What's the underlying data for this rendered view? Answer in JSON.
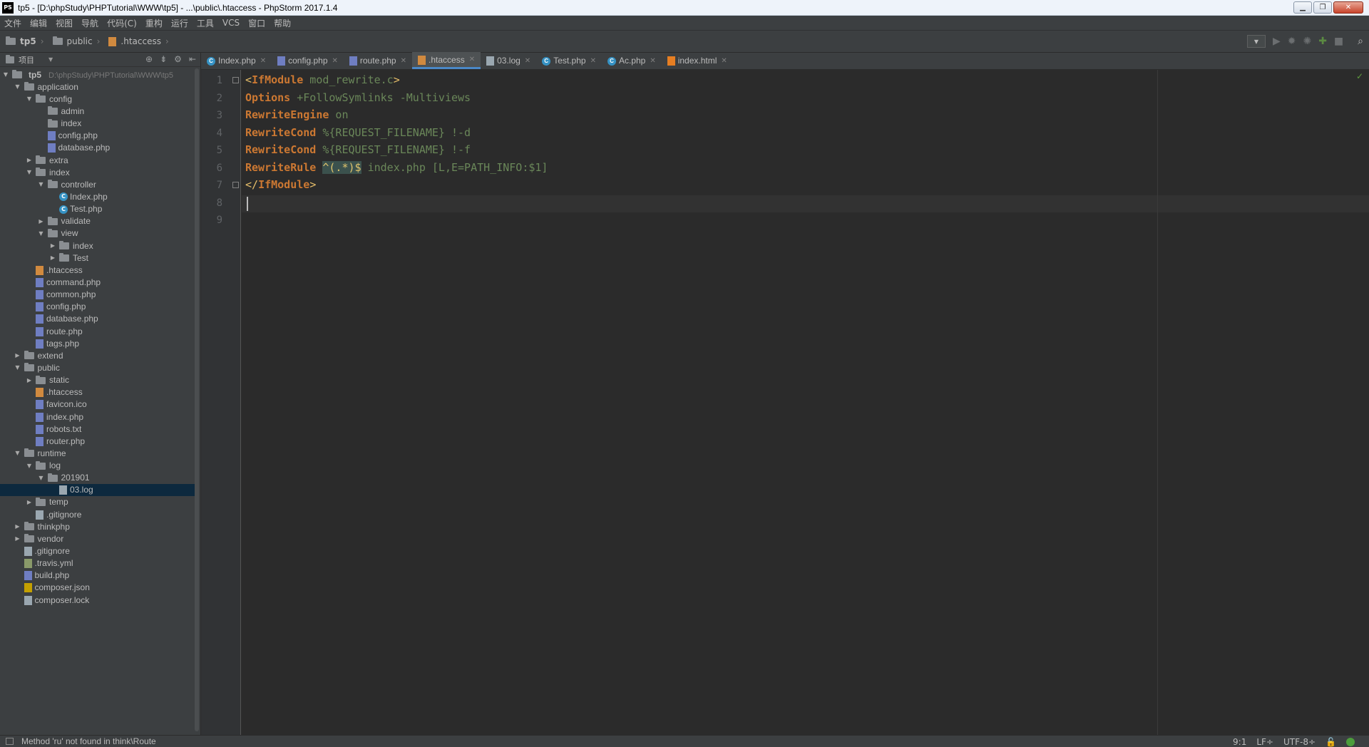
{
  "window": {
    "title": "tp5 - [D:\\phpStudy\\PHPTutorial\\WWW\\tp5] - ...\\public\\.htaccess - PhpStorm 2017.1.4",
    "logo": "PS"
  },
  "menu": [
    "文件",
    "编辑",
    "视图",
    "导航",
    "代码(C)",
    "重构",
    "运行",
    "工具",
    "VCS",
    "窗口",
    "帮助"
  ],
  "breadcrumb": [
    "tp5",
    "public",
    ".htaccess"
  ],
  "sidebar": {
    "header": "项目",
    "root_name": "tp5",
    "root_path": "D:\\phpStudy\\PHPTutorial\\WWW\\tp5",
    "items": [
      {
        "name": "application",
        "depth": 1,
        "kind": "folder",
        "expanded": true
      },
      {
        "name": "config",
        "depth": 2,
        "kind": "folder",
        "expanded": true
      },
      {
        "name": "admin",
        "depth": 3,
        "kind": "folder",
        "expanded": null
      },
      {
        "name": "index",
        "depth": 3,
        "kind": "folder",
        "expanded": null
      },
      {
        "name": "config.php",
        "depth": 3,
        "kind": "php"
      },
      {
        "name": "database.php",
        "depth": 3,
        "kind": "php"
      },
      {
        "name": "extra",
        "depth": 2,
        "kind": "folder",
        "expanded": false
      },
      {
        "name": "index",
        "depth": 2,
        "kind": "folder",
        "expanded": true
      },
      {
        "name": "controller",
        "depth": 3,
        "kind": "folder",
        "expanded": true
      },
      {
        "name": "Index.php",
        "depth": 4,
        "kind": "class"
      },
      {
        "name": "Test.php",
        "depth": 4,
        "kind": "class"
      },
      {
        "name": "validate",
        "depth": 3,
        "kind": "folder",
        "expanded": false
      },
      {
        "name": "view",
        "depth": 3,
        "kind": "folder",
        "expanded": true
      },
      {
        "name": "index",
        "depth": 4,
        "kind": "folder",
        "expanded": false
      },
      {
        "name": "Test",
        "depth": 4,
        "kind": "folder",
        "expanded": false
      },
      {
        "name": ".htaccess",
        "depth": 2,
        "kind": "ht"
      },
      {
        "name": "command.php",
        "depth": 2,
        "kind": "php"
      },
      {
        "name": "common.php",
        "depth": 2,
        "kind": "php"
      },
      {
        "name": "config.php",
        "depth": 2,
        "kind": "php"
      },
      {
        "name": "database.php",
        "depth": 2,
        "kind": "php"
      },
      {
        "name": "route.php",
        "depth": 2,
        "kind": "php"
      },
      {
        "name": "tags.php",
        "depth": 2,
        "kind": "php"
      },
      {
        "name": "extend",
        "depth": 1,
        "kind": "folder",
        "expanded": false
      },
      {
        "name": "public",
        "depth": 1,
        "kind": "folder",
        "expanded": true
      },
      {
        "name": "static",
        "depth": 2,
        "kind": "folder",
        "expanded": false
      },
      {
        "name": ".htaccess",
        "depth": 2,
        "kind": "ht"
      },
      {
        "name": "favicon.ico",
        "depth": 2,
        "kind": "php"
      },
      {
        "name": "index.php",
        "depth": 2,
        "kind": "php"
      },
      {
        "name": "robots.txt",
        "depth": 2,
        "kind": "php"
      },
      {
        "name": "router.php",
        "depth": 2,
        "kind": "php"
      },
      {
        "name": "runtime",
        "depth": 1,
        "kind": "folder",
        "expanded": true
      },
      {
        "name": "log",
        "depth": 2,
        "kind": "folder",
        "expanded": true
      },
      {
        "name": "201901",
        "depth": 3,
        "kind": "folder",
        "expanded": true
      },
      {
        "name": "03.log",
        "depth": 4,
        "kind": "log",
        "selected": true
      },
      {
        "name": "temp",
        "depth": 2,
        "kind": "folder",
        "expanded": false
      },
      {
        "name": ".gitignore",
        "depth": 2,
        "kind": "log"
      },
      {
        "name": "thinkphp",
        "depth": 1,
        "kind": "folder",
        "expanded": false
      },
      {
        "name": "vendor",
        "depth": 1,
        "kind": "folder",
        "expanded": false
      },
      {
        "name": ".gitignore",
        "depth": 1,
        "kind": "log"
      },
      {
        "name": ".travis.yml",
        "depth": 1,
        "kind": "yml"
      },
      {
        "name": "build.php",
        "depth": 1,
        "kind": "php"
      },
      {
        "name": "composer.json",
        "depth": 1,
        "kind": "json"
      },
      {
        "name": "composer.lock",
        "depth": 1,
        "kind": "log"
      }
    ]
  },
  "tabs": [
    {
      "label": "Index.php",
      "kind": "class",
      "active": false
    },
    {
      "label": "config.php",
      "kind": "php",
      "active": false
    },
    {
      "label": "route.php",
      "kind": "php",
      "active": false
    },
    {
      "label": ".htaccess",
      "kind": "ht",
      "active": true
    },
    {
      "label": "03.log",
      "kind": "log",
      "active": false
    },
    {
      "label": "Test.php",
      "kind": "class",
      "active": false
    },
    {
      "label": "Ac.php",
      "kind": "class",
      "active": false
    },
    {
      "label": "index.html",
      "kind": "html",
      "active": false
    }
  ],
  "editor": {
    "line_numbers": [
      "1",
      "2",
      "3",
      "4",
      "5",
      "6",
      "7",
      "8",
      "9"
    ],
    "lines": [
      [
        {
          "t": "<",
          "c": "t"
        },
        {
          "t": "IfModule",
          "c": "k"
        },
        {
          "t": " mod_rewrite.c",
          "c": "a"
        },
        {
          "t": ">",
          "c": "t"
        }
      ],
      [
        {
          "t": "Options",
          "c": "k"
        },
        {
          "t": " +FollowSymlinks -Multiviews",
          "c": "a"
        }
      ],
      [
        {
          "t": "RewriteEngine",
          "c": "k"
        },
        {
          "t": " on",
          "c": "a"
        }
      ],
      [
        {
          "t": "RewriteCond",
          "c": "k"
        },
        {
          "t": " %{REQUEST_FILENAME} !-d",
          "c": "a"
        }
      ],
      [
        {
          "t": "RewriteCond",
          "c": "k"
        },
        {
          "t": " %{REQUEST_FILENAME} !-f",
          "c": "a"
        }
      ],
      [
        {
          "t": "RewriteRule",
          "c": "k"
        },
        {
          "t": " ",
          "c": "plain"
        },
        {
          "t": "^(.*)$",
          "c": "hl"
        },
        {
          "t": " index.php [L,E=PATH_INFO:$1]",
          "c": "a"
        }
      ],
      [
        {
          "t": "</",
          "c": "t"
        },
        {
          "t": "IfModule",
          "c": "k"
        },
        {
          "t": ">",
          "c": "t"
        }
      ],
      [],
      []
    ]
  },
  "status": {
    "message": "Method 'ru' not found in think\\Route",
    "position": "9:1",
    "line_sep": "LF÷",
    "encoding": "UTF-8÷"
  }
}
